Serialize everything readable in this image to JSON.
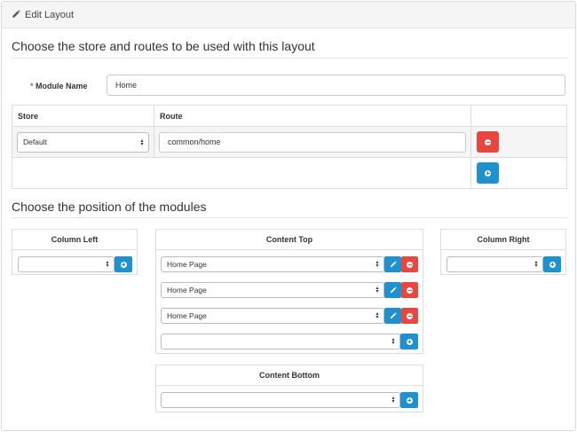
{
  "header": {
    "title": "Edit Layout",
    "icon": "pencil-icon"
  },
  "section1": {
    "legend": "Choose the store and routes to be used with this layout"
  },
  "module_name": {
    "label": "Module Name",
    "required_mark": "*",
    "value": "Home"
  },
  "route_table": {
    "headers": [
      "Store",
      "Route",
      ""
    ],
    "rows": [
      {
        "store": "Default",
        "route": "common/home"
      }
    ]
  },
  "section2": {
    "legend": "Choose the position of the modules"
  },
  "column_left": {
    "title": "Column Left",
    "select_value": ""
  },
  "content_top": {
    "title": "Content Top",
    "rows": [
      {
        "select_value": "Home Page"
      },
      {
        "select_value": "Home Page"
      },
      {
        "select_value": "Home Page"
      }
    ],
    "new_select_value": ""
  },
  "column_right": {
    "title": "Column Right",
    "select_value": ""
  },
  "content_bottom": {
    "title": "Content Bottom",
    "select_value": ""
  },
  "colors": {
    "danger": "#e8473f",
    "primary": "#1e91cf",
    "required": "#d9534f"
  }
}
